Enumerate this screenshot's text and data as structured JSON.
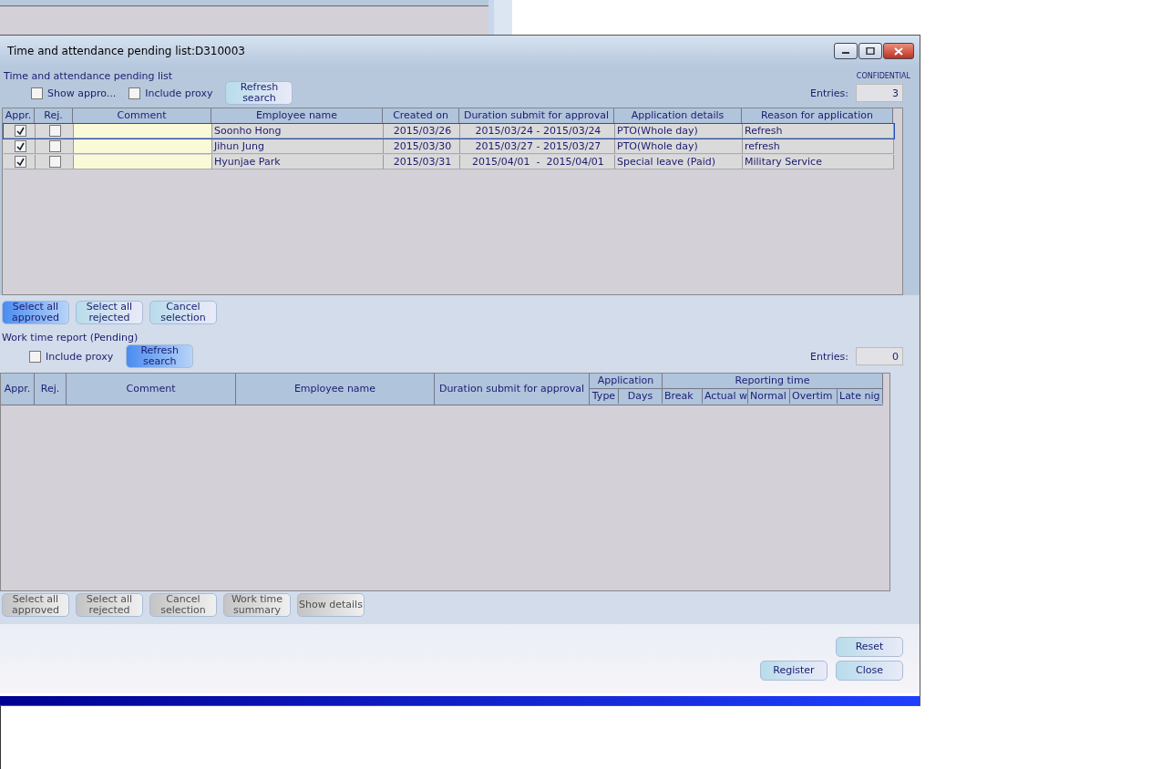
{
  "window": {
    "title": "Time and attendance pending list:D310003"
  },
  "pending": {
    "heading": "Time and attendance pending list",
    "badge": "CONFIDENTIAL",
    "filters": [
      {
        "label": "Show appro...",
        "checked": false
      },
      {
        "label": "Include proxy",
        "checked": false
      }
    ],
    "refresh": {
      "label": "Refresh search",
      "highlighted": false
    },
    "entries_label": "Entries:",
    "entries": "3",
    "columns": [
      "Appr.",
      "Rej.",
      "Comment",
      "Employee name",
      "Created on",
      "Duration submit for approval",
      "Application details",
      "Reason for application"
    ],
    "rows": [
      {
        "approved": true,
        "rejected": false,
        "selected": true,
        "employee": "Soonho Hong",
        "created": "2015/03/26",
        "duration": "2015/03/24 - 2015/03/24",
        "details": "PTO(Whole day)",
        "reason": "Refresh"
      },
      {
        "approved": true,
        "rejected": false,
        "selected": false,
        "employee": "Jihun Jung",
        "created": "2015/03/30",
        "duration": "2015/03/27 - 2015/03/27",
        "details": "PTO(Whole day)",
        "reason": "refresh"
      },
      {
        "approved": true,
        "rejected": false,
        "selected": false,
        "employee": "Hyunjae Park",
        "created": "2015/03/31",
        "duration": "2015/04/01  -  2015/04/01",
        "details": "Special leave (Paid)",
        "reason": "Military Service"
      }
    ],
    "buttons": [
      {
        "label": "Select all approved",
        "highlighted": true,
        "disabled": false
      },
      {
        "label": "Select all rejected",
        "highlighted": false,
        "disabled": false
      },
      {
        "label": "Cancel selection",
        "highlighted": false,
        "disabled": false
      }
    ]
  },
  "report": {
    "heading": "Work time report (Pending)",
    "filters": [
      {
        "label": "Include proxy",
        "checked": false
      }
    ],
    "refresh": {
      "label": "Refresh search",
      "highlighted": true
    },
    "entries_label": "Entries:",
    "entries": "0",
    "columns": [
      "Appr.",
      "Rej.",
      "Comment",
      "Employee name",
      "Duration submit for approval"
    ],
    "group_application": {
      "label": "Application",
      "columns": [
        "Type",
        "Days"
      ]
    },
    "group_reporting": {
      "label": "Reporting time",
      "columns": [
        "Break",
        "Actual w",
        "Normal",
        "Overtim",
        "Late nig"
      ]
    },
    "buttons": [
      {
        "label": "Select all approved",
        "disabled": true
      },
      {
        "label": "Select all rejected",
        "disabled": true
      },
      {
        "label": "Cancel selection",
        "disabled": true
      },
      {
        "label": "Work time summary",
        "disabled": true
      },
      {
        "label": "Show details",
        "disabled": true
      }
    ]
  },
  "footer": {
    "buttons": [
      {
        "label": "Reset",
        "disabled": false
      },
      {
        "label": "Register",
        "disabled": false
      },
      {
        "label": "Close",
        "disabled": false
      }
    ]
  }
}
